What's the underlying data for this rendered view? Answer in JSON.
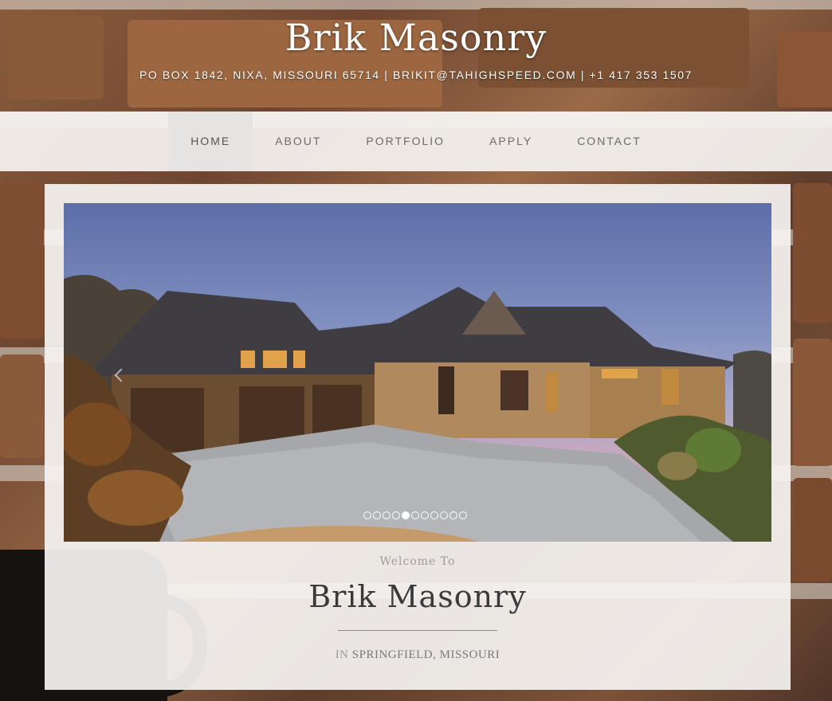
{
  "header": {
    "title": "Brik Masonry",
    "info": "PO BOX 1842, NIXA, MISSOURI 65714 | BRIKIT@TAHIGHSPEED.COM | +1 417 353 1507"
  },
  "nav": {
    "items": [
      {
        "label": "HOME",
        "active": true
      },
      {
        "label": "ABOUT",
        "active": false
      },
      {
        "label": "PORTFOLIO",
        "active": false
      },
      {
        "label": "APPLY",
        "active": false
      },
      {
        "label": "CONTACT",
        "active": false
      }
    ]
  },
  "slider": {
    "image_alt": "Stone and stucco house with three-car garage at dusk",
    "dot_count": 11,
    "active_dot": 5
  },
  "welcome": {
    "intro": "Welcome To",
    "title": "Brik Masonry",
    "location_prefix": "IN",
    "location_city": "SPRINGFIELD, MISSOURI"
  },
  "colors": {
    "panel": "#f5f3f1",
    "nav_active": "#e6e4e2",
    "nav_text": "#6b6b6b",
    "heading": "#3a3a3a"
  }
}
